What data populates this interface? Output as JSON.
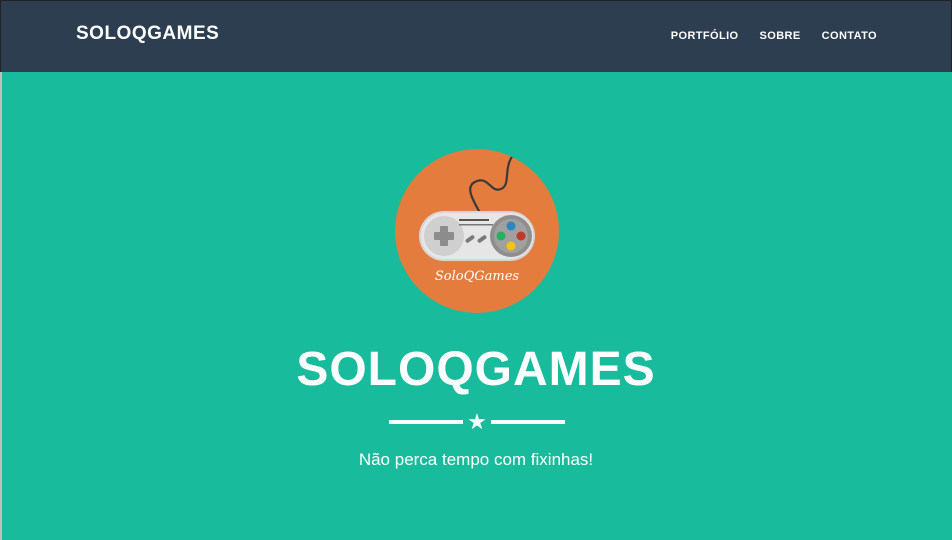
{
  "navbar": {
    "brand": "SOLOQGAMES",
    "items": [
      {
        "label": "PORTFÓLIO"
      },
      {
        "label": "SOBRE"
      },
      {
        "label": "CONTATO"
      }
    ]
  },
  "hero": {
    "logo_caption": "SoloQGames",
    "title": "SOLOQGAMES",
    "divider_icon": "star-icon",
    "tagline": "Não perca tempo com fixinhas!"
  },
  "colors": {
    "navbar_bg": "#2c3e50",
    "hero_bg": "#18bc9c",
    "logo_circle": "#e47c3d",
    "text": "#ffffff"
  }
}
